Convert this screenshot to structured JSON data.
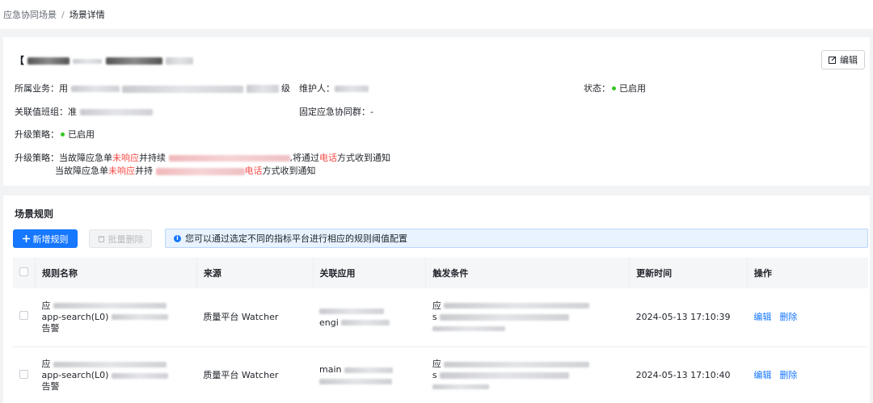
{
  "breadcrumb": {
    "parent": "应急协同场景",
    "separator": "/",
    "current": "场景详情"
  },
  "info": {
    "title_prefix": "【",
    "edit_label": "编辑",
    "business_label": "所属业务：",
    "business_value": "用",
    "business_tail": "级",
    "maintainer_label": "维护人：",
    "status_label": "状态：",
    "status_value": "已启用",
    "oncall_label": "关联值班组：",
    "oncall_value": "准",
    "fixed_group_label": "固定应急协同群：",
    "fixed_group_value": "-",
    "upgrade_label": "升级策略：",
    "upgrade_value": "已启用",
    "strategy_label": "升级策略：",
    "strategy_1_a": "当故障应急单",
    "strategy_1_red": "未响应",
    "strategy_1_b": "并持续",
    "strategy_1_c": ",将通过",
    "strategy_1_red2": "电话",
    "strategy_1_d": "方式收到通知",
    "strategy_2_a": "当故障应急单",
    "strategy_2_red": "未响应",
    "strategy_2_b": "并持",
    "strategy_2_red2": "电话",
    "strategy_2_d": "方式收到通知"
  },
  "rules": {
    "section_title": "场景规则",
    "add_button": "新增规则",
    "batch_delete": "批量删除",
    "notice": "您可以通过选定不同的指标平台进行相应的规则阈值配置",
    "columns": [
      "规则名称",
      "来源",
      "关联应用",
      "触发条件",
      "更新时间",
      "操作"
    ],
    "rows": [
      {
        "name_line1": "应",
        "name_line2": "app-search(L0)",
        "name_line3": "告警",
        "source": "质量平台 Watcher",
        "app": "engi",
        "trigger_line1": "应",
        "trigger_line2": "s",
        "updated": "2024-05-13 17:10:39",
        "edit": "编辑",
        "delete": "删除"
      },
      {
        "name_line1": "应",
        "name_line2": "app-search(L0)",
        "name_line3": "告警",
        "source": "质量平台 Watcher",
        "app": "main",
        "trigger_line1": "应",
        "trigger_line2": "s",
        "updated": "2024-05-13 17:10:40",
        "edit": "编辑",
        "delete": "删除"
      }
    ]
  }
}
